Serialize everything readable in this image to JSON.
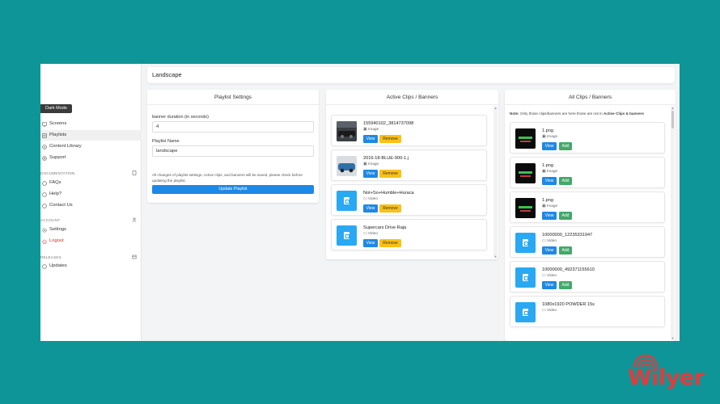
{
  "header": {
    "title": "Landscape"
  },
  "sidebar": {
    "dark_mode_label": "Dark Mode",
    "items": [
      {
        "label": "Screens",
        "icon": "monitor-icon"
      },
      {
        "label": "Playlists",
        "icon": "playlist-icon",
        "active": true
      },
      {
        "label": "Content Library",
        "icon": "library-icon"
      },
      {
        "label": "Support",
        "icon": "support-icon"
      }
    ],
    "documentation": {
      "label": "DOCUMENTATION",
      "items": [
        "FAQs",
        "Help?",
        "Contact Us"
      ]
    },
    "account": {
      "label": "ACCOUNT",
      "items": [
        "Settings",
        "Logout"
      ]
    },
    "releases": {
      "label": "RELEASES",
      "items": [
        "Updates"
      ]
    }
  },
  "settings": {
    "title": "Playlist Settings",
    "duration_label": "banner duration (in seconds)",
    "duration_value": "4",
    "name_label": "Playlist Name",
    "name_value": "landscape",
    "note": "All changes of playlist settings, Active clips, and banners will be saved, please check before updating the playlist.",
    "update_button": "Update Playlist"
  },
  "active_clips": {
    "title": "Active Clips / Banners",
    "view_label": "View",
    "remove_label": "Remove",
    "items": [
      {
        "name": "155940102_3814737098",
        "type": "Image",
        "thumb": "photo-car-dark"
      },
      {
        "name": "2016-18-BLUE-900-1.j",
        "type": "Image",
        "thumb": "photo-car-blue"
      },
      {
        "name": "Not+So+Humble+Huraca",
        "type": "Video",
        "thumb": "file"
      },
      {
        "name": "Supercars Drive Raja",
        "type": "Video",
        "thumb": "file"
      }
    ]
  },
  "all_clips": {
    "title": "All Clips / Banners",
    "note_prefix": "Note:",
    "note_text": "Only those clips/banners are here those are not in",
    "note_bold": "Active Clips & banners",
    "view_label": "View",
    "add_label": "Add",
    "items": [
      {
        "name": "1.png",
        "type": "Image",
        "thumb": "dark"
      },
      {
        "name": "1.png",
        "type": "Image",
        "thumb": "dark"
      },
      {
        "name": "1.png",
        "type": "Image",
        "thumb": "dark"
      },
      {
        "name": "10000000_12235331947",
        "type": "Video",
        "thumb": "file"
      },
      {
        "name": "10000000_492371155610",
        "type": "Video",
        "thumb": "file"
      },
      {
        "name": "1080x1920 POWDER 15s",
        "type": "Video",
        "thumb": "file"
      }
    ]
  },
  "brand": {
    "logo_text": "Wilyer",
    "accent": "#e23b3b",
    "background": "#0e9597",
    "primary": "#1e88e5",
    "warning": "#f9c115",
    "success": "#43a869"
  }
}
